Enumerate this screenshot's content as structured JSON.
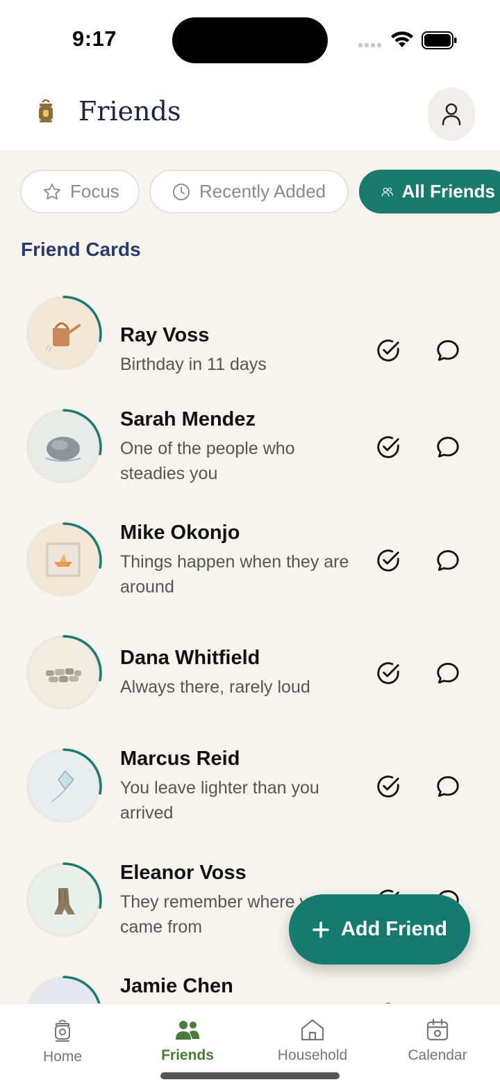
{
  "status_bar": {
    "time": "9:17"
  },
  "header": {
    "title": "Friends",
    "app_icon": "lantern-icon",
    "profile_icon": "person-icon"
  },
  "filters": [
    {
      "label": "Focus",
      "icon": "star-icon",
      "active": false
    },
    {
      "label": "Recently Added",
      "icon": "clock-icon",
      "active": false
    },
    {
      "label": "All Friends",
      "icon": "people-icon",
      "active": true
    }
  ],
  "section_title": "Friend Cards",
  "friends": [
    {
      "name": "Ray Voss",
      "subtitle": "Birthday in 11 days",
      "avatar": "watering-can",
      "progress": 0.28
    },
    {
      "name": "Sarah Mendez",
      "subtitle": "One of the people who steadies you",
      "avatar": "stone",
      "progress": 0.28
    },
    {
      "name": "Mike Okonjo",
      "subtitle": "Things happen when they are around",
      "avatar": "paper-boat",
      "progress": 0.28
    },
    {
      "name": "Dana Whitfield",
      "subtitle": "Always there, rarely loud",
      "avatar": "stone-wall",
      "progress": 0.28
    },
    {
      "name": "Marcus Reid",
      "subtitle": "You leave lighter than you arrived",
      "avatar": "kite",
      "progress": 0.28
    },
    {
      "name": "Eleanor Voss",
      "subtitle": "They remember where you came from",
      "avatar": "tree-stump",
      "progress": 0.28
    },
    {
      "name": "Jamie Chen",
      "subtitle": "",
      "avatar": "bare-tree",
      "progress": 0.28
    }
  ],
  "fab": {
    "label": "Add Friend"
  },
  "tabs": [
    {
      "label": "Home",
      "icon": "lantern-icon",
      "active": false
    },
    {
      "label": "Friends",
      "icon": "people-icon",
      "active": true
    },
    {
      "label": "Household",
      "icon": "house-icon",
      "active": false
    },
    {
      "label": "Calendar",
      "icon": "calendar-icon",
      "active": false
    }
  ],
  "colors": {
    "accent": "#1a7a6e",
    "active_tab": "#4a7a3c",
    "section_title": "#2b3a6b",
    "background": "#f7f4ef"
  }
}
